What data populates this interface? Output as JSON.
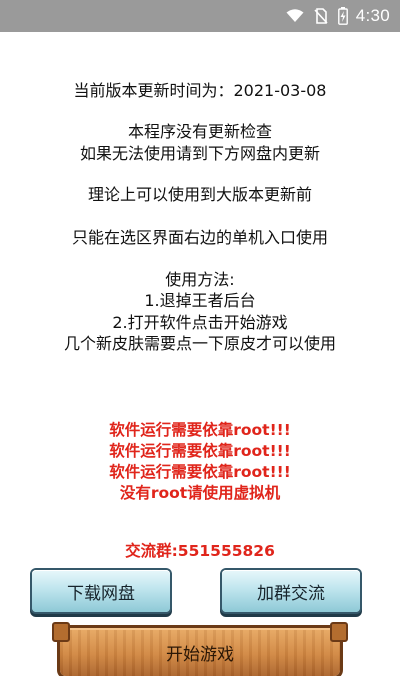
{
  "status_bar": {
    "time": "4:30",
    "icons": [
      "wifi-icon",
      "no-sim-icon",
      "battery-charging-icon"
    ]
  },
  "info": {
    "update_time": "当前版本更新时间为：2021-03-08",
    "no_update_check": "本程序没有更新检查",
    "update_hint": "如果无法使用请到下方网盘内更新",
    "usable_until": "理论上可以使用到大版本更新前",
    "entry_hint": "只能在选区界面右边的单机入口使用",
    "usage_title": "使用方法:",
    "step1": "1.退掉王者后台",
    "step2": "2.打开软件点击开始游戏",
    "skin_hint": "几个新皮肤需要点一下原皮才可以使用"
  },
  "warnings": {
    "root1": "软件运行需要依靠root!!!",
    "root2": "软件运行需要依靠root!!!",
    "root3": "软件运行需要依靠root!!!",
    "no_root": "没有root请使用虚拟机",
    "group": "交流群:551555826"
  },
  "buttons": {
    "download": "下载网盘",
    "join_group": "加群交流",
    "start": "开始游戏"
  },
  "colors": {
    "status_bar": "#9a9a9a",
    "warning": "#e0251b",
    "small_button": "#bfe5ee",
    "start_button": "#cf8642"
  }
}
